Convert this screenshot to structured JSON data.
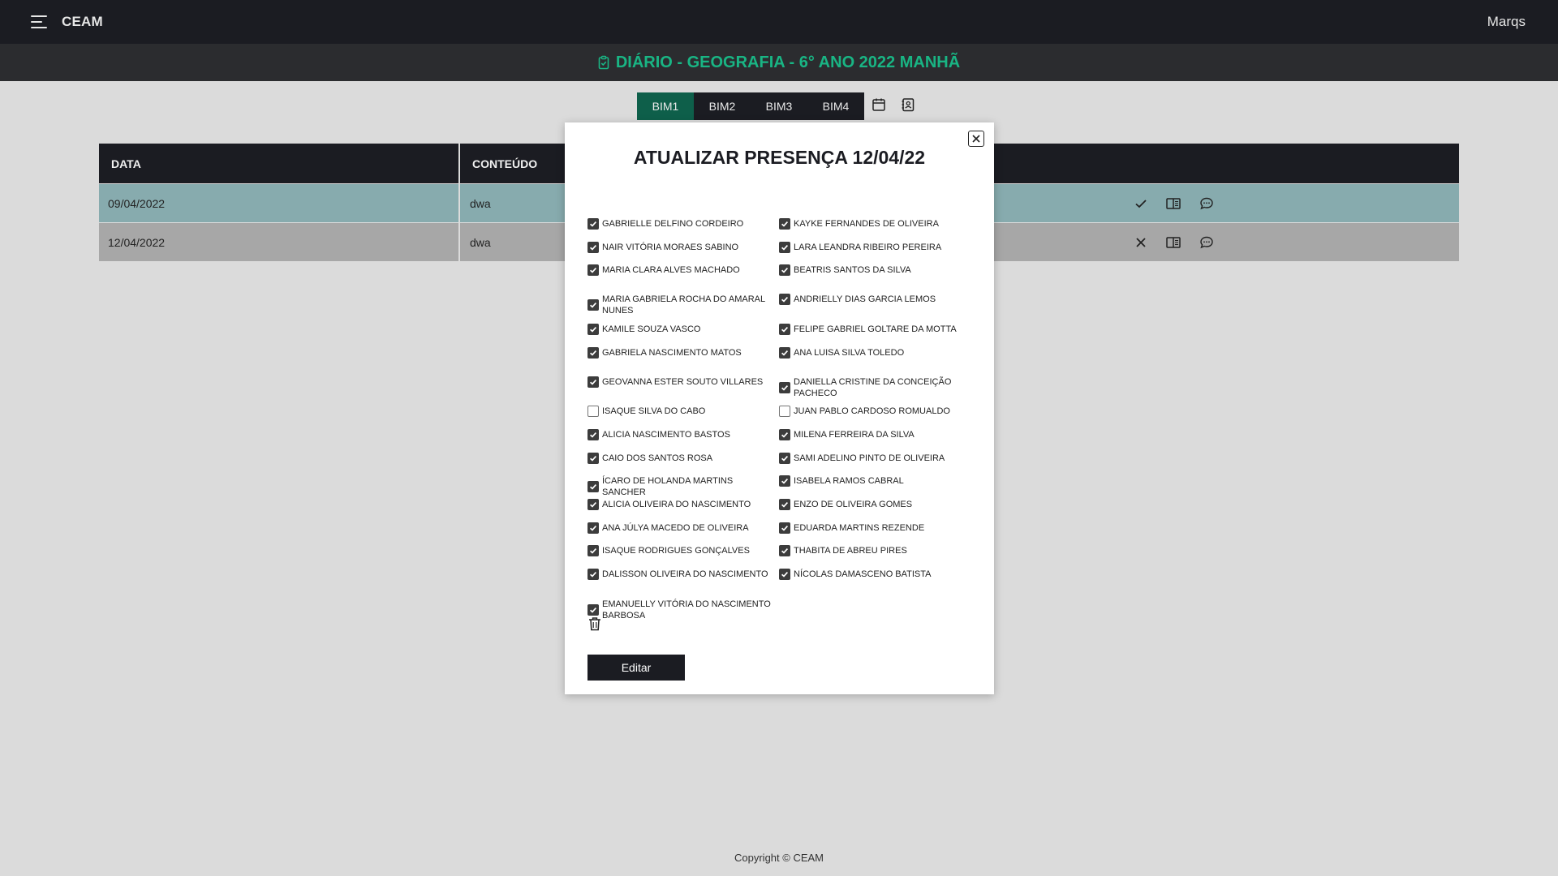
{
  "navbar": {
    "brand": "CEAM",
    "user": "Marqs"
  },
  "page_title": "DIÁRIO - GEOGRAFIA - 6° ANO 2022 MANHÃ",
  "tabs": [
    {
      "label": "BIM1",
      "active": true
    },
    {
      "label": "BIM2",
      "active": false
    },
    {
      "label": "BIM3",
      "active": false
    },
    {
      "label": "BIM4",
      "active": false
    }
  ],
  "table": {
    "headers": [
      "DATA",
      "CONTEÚDO"
    ],
    "rows": [
      {
        "data": "09/04/2022",
        "conteudo": "dwa",
        "status_icon": "check-icon"
      },
      {
        "data": "12/04/2022",
        "conteudo": "dwa",
        "status_icon": "x-icon"
      }
    ]
  },
  "modal": {
    "title": "ATUALIZAR PRESENÇA 12/04/22",
    "edit_label": "Editar",
    "left_column": [
      {
        "name": "GABRIELLE DELFINO CORDEIRO",
        "checked": true
      },
      {
        "name": "NAIR VITÓRIA MORAES SABINO",
        "checked": true
      },
      {
        "name": "MARIA CLARA ALVES MACHADO",
        "checked": true
      },
      {
        "name": "MARIA GABRIELA ROCHA DO AMARAL NUNES",
        "checked": true
      },
      {
        "name": "KAMILE SOUZA VASCO",
        "checked": true
      },
      {
        "name": "GABRIELA NASCIMENTO MATOS",
        "checked": true
      },
      {
        "name": "GEOVANNA ESTER SOUTO VILLARES",
        "checked": true
      },
      {
        "name": "ISAQUE SILVA DO CABO",
        "checked": false
      },
      {
        "name": "ALICIA NASCIMENTO BASTOS",
        "checked": true
      },
      {
        "name": "CAIO DOS SANTOS ROSA",
        "checked": true
      },
      {
        "name": "ÍCARO DE HOLANDA MARTINS SANCHER",
        "checked": true
      },
      {
        "name": "ALICIA OLIVEIRA DO NASCIMENTO",
        "checked": true
      },
      {
        "name": "ANA JÚLYA MACEDO DE OLIVEIRA",
        "checked": true
      },
      {
        "name": "ISAQUE RODRIGUES GONÇALVES",
        "checked": true
      },
      {
        "name": "DALISSON OLIVEIRA DO NASCIMENTO",
        "checked": true
      },
      {
        "name": "EMANUELLY VITÓRIA DO NASCIMENTO BARBOSA",
        "checked": true
      }
    ],
    "right_column": [
      {
        "name": "KAYKE FERNANDES DE OLIVEIRA",
        "checked": true
      },
      {
        "name": "LARA LEANDRA RIBEIRO PEREIRA",
        "checked": true
      },
      {
        "name": "BEATRIS SANTOS DA SILVA",
        "checked": true
      },
      {
        "name": "ANDRIELLY DIAS GARCIA LEMOS",
        "checked": true
      },
      {
        "name": "FELIPE GABRIEL GOLTARE DA MOTTA",
        "checked": true
      },
      {
        "name": "ANA LUISA SILVA TOLEDO",
        "checked": true
      },
      {
        "name": "DANIELLA CRISTINE DA CONCEIÇÃO PACHECO",
        "checked": true
      },
      {
        "name": "JUAN PABLO CARDOSO ROMUALDO",
        "checked": false
      },
      {
        "name": "MILENA FERREIRA DA SILVA",
        "checked": true
      },
      {
        "name": "SAMI ADELINO PINTO DE OLIVEIRA",
        "checked": true
      },
      {
        "name": "ISABELA RAMOS CABRAL",
        "checked": true
      },
      {
        "name": "ENZO DE OLIVEIRA GOMES",
        "checked": true
      },
      {
        "name": "EDUARDA MARTINS REZENDE",
        "checked": true
      },
      {
        "name": "THABITA DE ABREU PIRES",
        "checked": true
      },
      {
        "name": "NÍCOLAS DAMASCENO BATISTA",
        "checked": true
      }
    ]
  },
  "footer": "Copyright © CEAM"
}
